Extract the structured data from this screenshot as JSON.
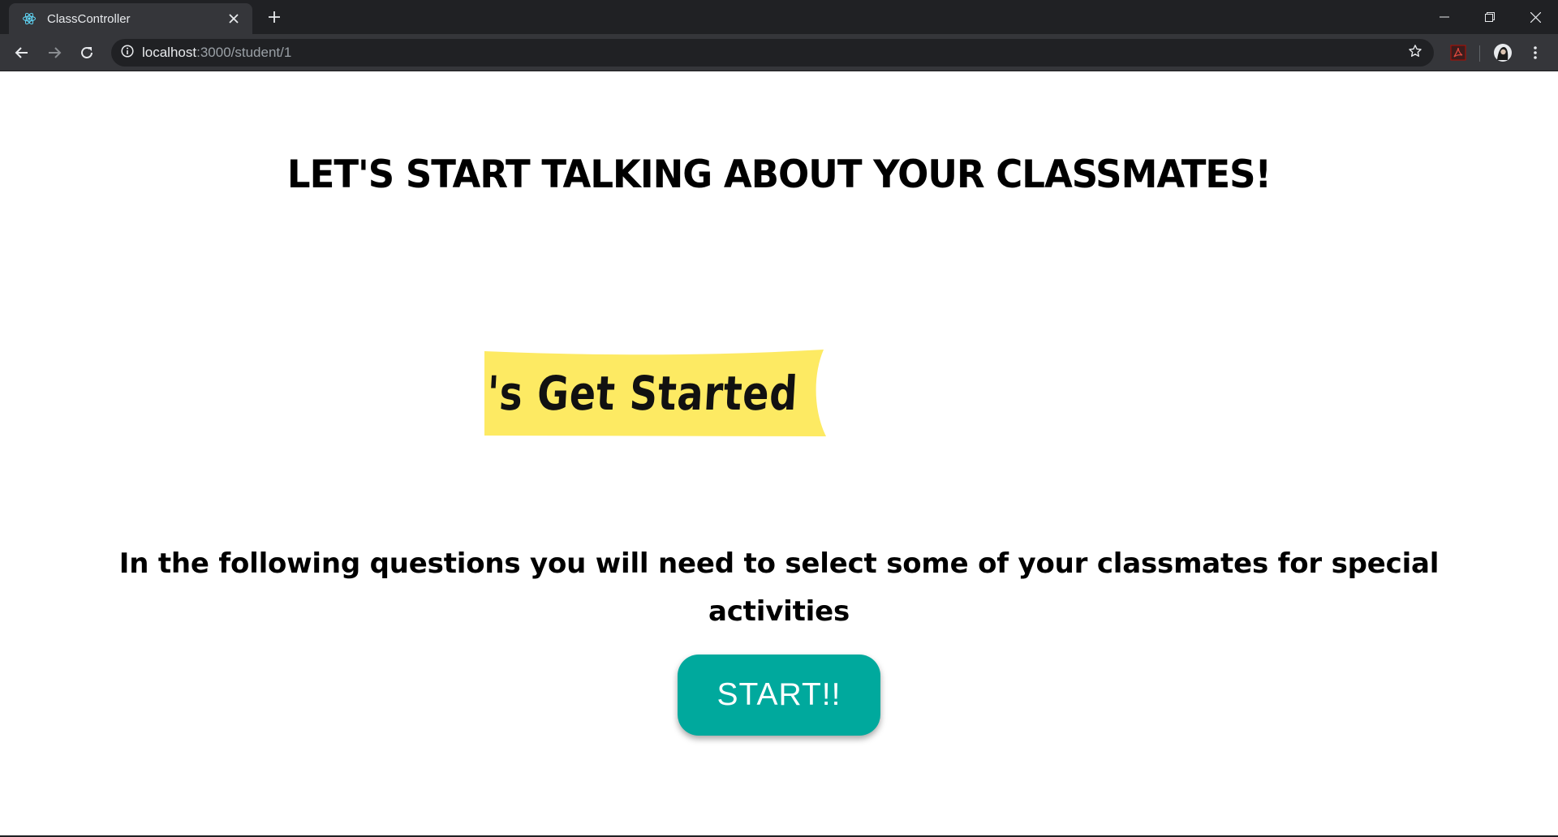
{
  "browser": {
    "tab": {
      "title": "ClassController",
      "favicon": "react-icon"
    },
    "address_bar": {
      "host": "localhost",
      "path": ":3000/student/1"
    }
  },
  "page": {
    "heading": "LET'S START TALKING ABOUT YOUR CLASSMATES!",
    "banner_text": "'s Get Started",
    "instructions": "In the following questions you will need to select some of your classmates for special activities",
    "start_button": "START!!"
  },
  "colors": {
    "button": "#00a99d",
    "banner": "#fdea63",
    "chrome_dark": "#202124",
    "chrome_toolbar": "#35363a"
  }
}
